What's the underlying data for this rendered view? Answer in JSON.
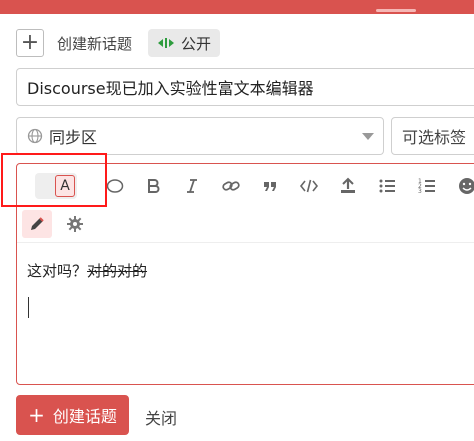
{
  "header": {
    "accent": "#d9534f"
  },
  "composer": {
    "action_label": "创建新话题",
    "visibility_label": "公开",
    "title_value": "Discourse现已加入实验性富文本编辑器",
    "category_value": "同步区",
    "tags_placeholder": "可选标签",
    "toolbar": {
      "mode_toggle_label": "A",
      "buttons": [
        "emoji-bubble",
        "bold",
        "italic",
        "link",
        "quote",
        "code",
        "upload",
        "bullet-list",
        "numbered-list",
        "emoji"
      ]
    },
    "content": {
      "plain_text": "这对吗？",
      "strikethrough_text": "对的对的"
    },
    "footer": {
      "create_label": "创建话题",
      "close_label": "关闭"
    }
  }
}
